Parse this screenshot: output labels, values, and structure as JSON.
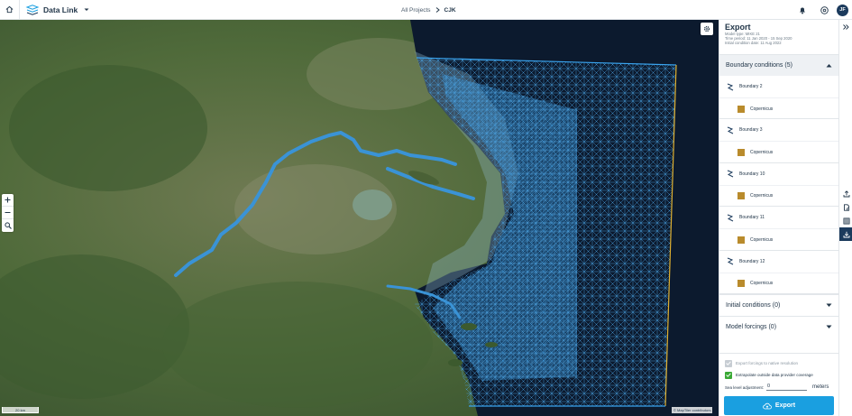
{
  "app": {
    "name": "Data Link",
    "breadcrumb": {
      "parent": "All Projects",
      "current": "CJK"
    },
    "user_initials": "JF"
  },
  "map": {
    "scale_label": "20 km",
    "attribution": "© MapTiler contributors"
  },
  "panel": {
    "title": "Export",
    "meta": [
      "Model type: MIKE 21",
      "Time period: 11 Jan 2020 - 15 Sep 2020",
      "Initial condition date: 11 Aug 2022"
    ],
    "boundary_header": "Boundary conditions (5)",
    "boundaries": [
      {
        "label": "Boundary 2",
        "source": "Copernicus"
      },
      {
        "label": "Boundary 3",
        "source": "Copernicus"
      },
      {
        "label": "Boundary 10",
        "source": "Copernicus"
      },
      {
        "label": "Boundary 11",
        "source": "Copernicus"
      },
      {
        "label": "Boundary 12",
        "source": "Copernicus"
      }
    ],
    "initial_header": "Initial conditions (0)",
    "forcings_header": "Model forcings (0)",
    "opt_native": "Export forcings to native resolution",
    "opt_extrapolate": "Extrapolate outside data provider coverage",
    "sea_level_label": "Sea level adjustment:",
    "sea_level_value": "0",
    "sea_level_unit": "meters",
    "export_button": "Export"
  },
  "colors": {
    "accent": "#1a9fe0",
    "navy": "#1b3a5c",
    "mesh": "#2f86c9",
    "ocean": "#0c1a2e",
    "check_on": "#3aa935"
  }
}
